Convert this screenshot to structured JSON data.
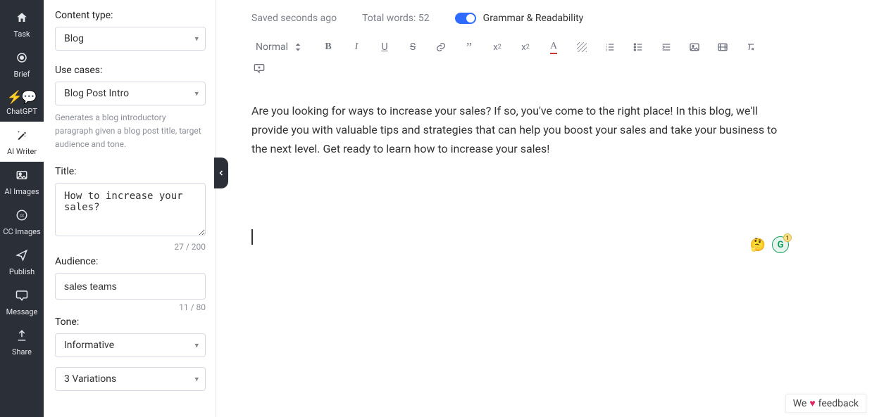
{
  "rail": {
    "items": [
      {
        "name": "task",
        "label": "Task",
        "icon": "home"
      },
      {
        "name": "brief",
        "label": "Brief",
        "icon": "target"
      },
      {
        "name": "chatgpt",
        "label": "ChatGPT",
        "icon": "bolt-chat"
      },
      {
        "name": "ai-writer",
        "label": "AI Writer",
        "icon": "wand"
      },
      {
        "name": "ai-images",
        "label": "AI Images",
        "icon": "picture"
      },
      {
        "name": "cc-images",
        "label": "CC Images",
        "icon": "cc"
      },
      {
        "name": "publish",
        "label": "Publish",
        "icon": "send"
      },
      {
        "name": "message",
        "label": "Message",
        "icon": "chat"
      },
      {
        "name": "share",
        "label": "Share",
        "icon": "upload"
      }
    ]
  },
  "panel": {
    "content_type_label": "Content type:",
    "content_type_value": "Blog",
    "use_cases_label": "Use cases:",
    "use_cases_value": "Blog Post Intro",
    "use_cases_desc": "Generates a blog introductory paragraph given a blog post title, target audience and tone.",
    "title_label": "Title:",
    "title_value": "How to increase your sales?",
    "title_count": "27 / 200",
    "audience_label": "Audience:",
    "audience_value": "sales teams",
    "audience_count": "11 / 80",
    "tone_label": "Tone:",
    "tone_value": "Informative",
    "variations_value": "3 Variations"
  },
  "status": {
    "saved": "Saved seconds ago",
    "words_label": "Total words: ",
    "words_value": "52",
    "toggle_label": "Grammar & Readability"
  },
  "toolbar": {
    "normal": "Normal"
  },
  "content": {
    "body": "Are you looking for ways to increase your sales? If so, you've come to the right place! In this blog, we'll provide you with valuable tips and strategies that can help you boost your sales and take your business to the next level. Get ready to learn how to increase your sales!"
  },
  "badges": {
    "emoji": "🤔",
    "g": "G",
    "g_note": "1"
  },
  "feedback": {
    "prefix": "We",
    "suffix": "feedback"
  }
}
